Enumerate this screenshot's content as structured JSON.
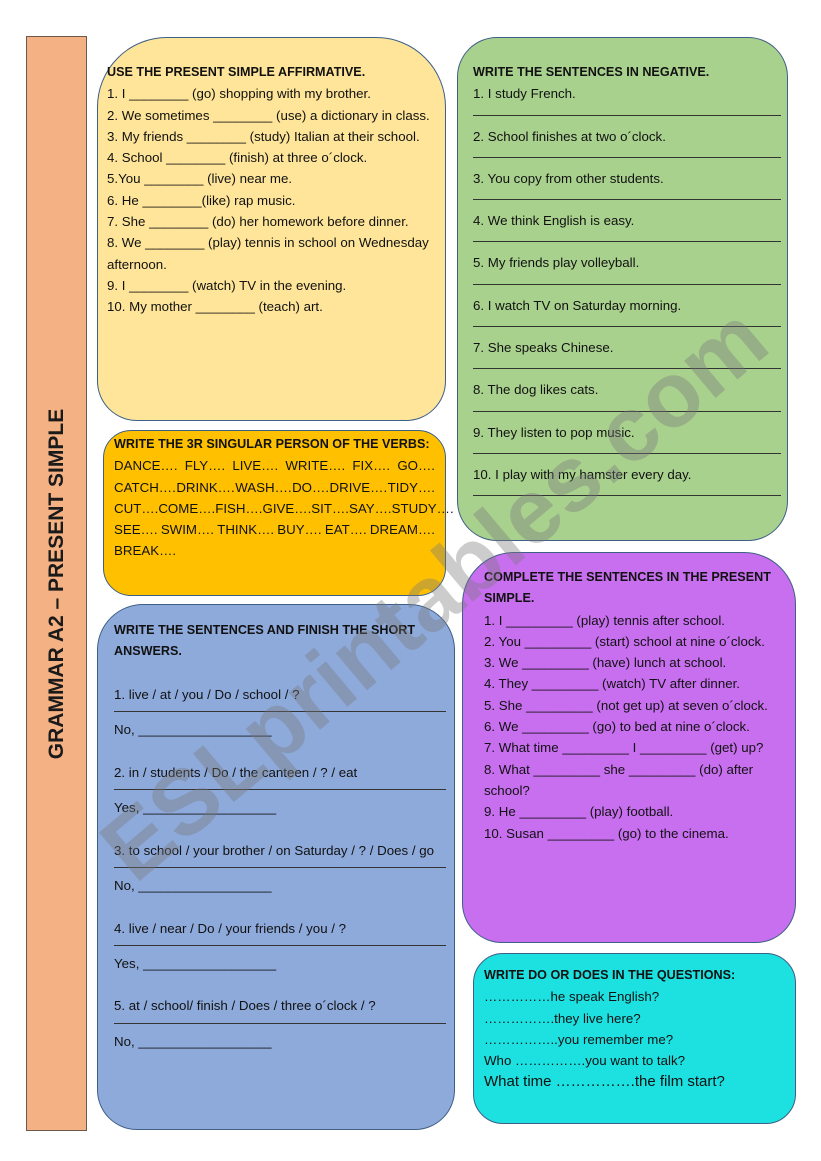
{
  "title": "GRAMMAR A2 – PRESENT SIMPLE",
  "watermark": "ESLprintables.com",
  "colors": {
    "title_bar": "#f4b183",
    "yellow": "#fee599",
    "green": "#a9d18e",
    "orange": "#ffc000",
    "blue": "#8eaadb",
    "purple": "#c86ff0",
    "cyan": "#1de0e0"
  },
  "affirmative": {
    "heading": "USE THE PRESENT SIMPLE  AFFIRMATIVE.",
    "items": [
      "1. I ________ (go) shopping with my brother.",
      "2. We sometimes ________ (use) a dictionary in class.",
      "3. My friends ________ (study) Italian at their school.",
      "4. School ________ (finish) at three o´clock.",
      "5.You ________ (live) near me.",
      "6. He ________(like) rap music.",
      "7. She ________ (do) her homework before dinner.",
      "8. We ________ (play) tennis in school on Wednesday afternoon.",
      "9. I ________ (watch) TV in the evening.",
      "10. My mother ________ (teach) art."
    ]
  },
  "negative": {
    "heading": "WRITE THE SENTENCES IN NEGATIVE.",
    "items": [
      "1. I study French.",
      "2. School finishes at two o´clock.",
      "3. You copy from other students.",
      "4. We think English is easy.",
      "5. My friends play volleyball.",
      "6. I watch TV on Saturday morning.",
      "7. She speaks Chinese.",
      "8. The dog likes cats.",
      "9. They listen to pop music.",
      "10. I play with my hamster every day."
    ]
  },
  "verbs": {
    "heading": "WRITE THE 3R SINGULAR PERSON OF THE VERBS:",
    "rows": [
      [
        "DANCE….",
        "FLY….",
        "LIVE….",
        "WRITE….",
        "FIX….",
        "GO…."
      ],
      [
        "CATCH….",
        "DRINK….",
        "WASH….",
        "DO….",
        "DRIVE….",
        "TIDY…."
      ],
      [
        "CUT….",
        "COME….",
        "FISH….",
        "GIVE….",
        "SIT….",
        "SAY….",
        "STUDY…."
      ],
      [
        "SEE….",
        "SWIM….",
        "THINK….",
        "BUY….",
        "EAT….",
        "DREAM…."
      ],
      [
        "BREAK…."
      ]
    ]
  },
  "short_answers": {
    "heading": "WRITE THE SENTENCES AND FINISH THE SHORT ANSWERS.",
    "items": [
      {
        "q": "1. live / at / you / Do / school / ?",
        "a": "No, __________________"
      },
      {
        "q": "2. in / students / Do / the canteen / ? / eat",
        "a": "Yes, __________________"
      },
      {
        "q": "3. to school / your brother / on Saturday / ? / Does / go",
        "a": "No, __________________"
      },
      {
        "q": "4. live / near / Do / your friends / you / ?",
        "a": "Yes, __________________"
      },
      {
        "q": "5. at / school/ finish / Does / three o´clock / ?",
        "a": "No, __________________"
      }
    ]
  },
  "complete": {
    "heading": "COMPLETE THE SENTENCES IN THE PRESENT SIMPLE.",
    "items": [
      "1. I _________ (play) tennis after school.",
      "2. You _________ (start) school at nine o´clock.",
      "3. We _________ (have) lunch at school.",
      "4. They _________ (watch) TV after dinner.",
      "5. She _________ (not get up) at seven o´clock.",
      "6. We _________ (go) to bed at nine o´clock.",
      "7. What time _________ I _________ (get) up?",
      "8. What _________ she _________ (do) after school?",
      "9. He _________ (play) football.",
      "10. Susan _________ (go) to the cinema."
    ]
  },
  "do_does": {
    "heading": "WRITE DO OR DOES IN THE QUESTIONS:",
    "items": [
      "……………he speak English?",
      "…………….they live here?",
      "……………..you remember me?",
      "Who …………….you want to talk?",
      "What time …………….the film start?"
    ]
  }
}
